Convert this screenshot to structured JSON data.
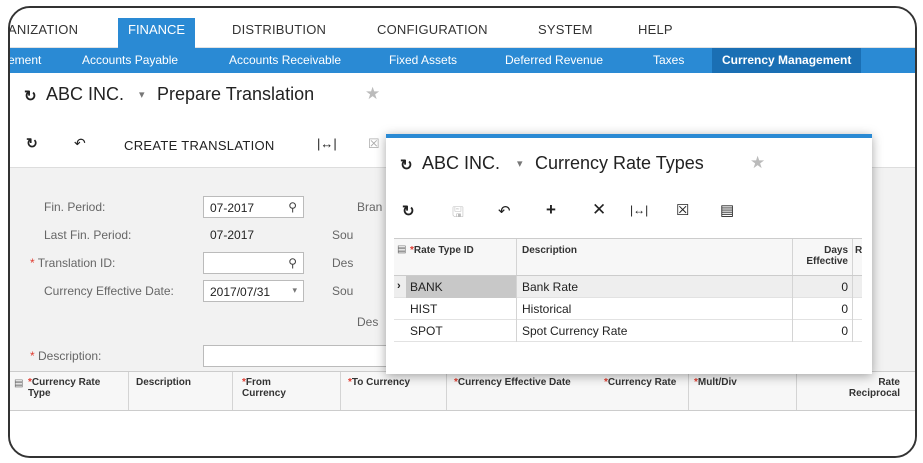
{
  "topnav": {
    "items": [
      "ANIZATION",
      "FINANCE",
      "DISTRIBUTION",
      "CONFIGURATION",
      "SYSTEM",
      "HELP"
    ],
    "active_index": 1
  },
  "subnav": {
    "items": [
      "ement",
      "Accounts Payable",
      "Accounts Receivable",
      "Fixed Assets",
      "Deferred Revenue",
      "Taxes",
      "Currency Management"
    ],
    "active_index": 6
  },
  "titlebar": {
    "company": "ABC INC.",
    "screen_title": "Prepare Translation"
  },
  "toolbar": {
    "create_translation": "CREATE TRANSLATION"
  },
  "form": {
    "fin_period_label": "Fin. Period:",
    "fin_period_value": "07-2017",
    "last_fin_period_label": "Last Fin. Period:",
    "last_fin_period_value": "07-2017",
    "translation_id_label": "Translation ID:",
    "translation_id_value": "",
    "currency_effective_date_label": "Currency Effective Date:",
    "currency_effective_date_value": "2017/07/31",
    "description_label": "Description:",
    "description_value": "",
    "right_labels": [
      "Bran",
      "Sou",
      "Des",
      "Sou",
      "Des"
    ]
  },
  "grid": {
    "columns": [
      {
        "label": "Currency Rate Type",
        "required": true
      },
      {
        "label": "Description",
        "required": false
      },
      {
        "label": "From Currency",
        "required": true
      },
      {
        "label": "To Currency",
        "required": true
      },
      {
        "label": "Currency Effective Date",
        "required": true
      },
      {
        "label": "Currency Rate",
        "required": true
      },
      {
        "label": "Mult/Div",
        "required": true
      },
      {
        "label": "Rate Reciprocal",
        "required": false
      }
    ]
  },
  "popup": {
    "company": "ABC INC.",
    "screen_title": "Currency Rate Types",
    "columns": [
      {
        "label": "Rate Type ID",
        "required": true
      },
      {
        "label": "Description",
        "required": false
      },
      {
        "label": "Days Effective",
        "required": false
      },
      {
        "label": "R",
        "required": false
      }
    ],
    "rows": [
      {
        "id": "BANK",
        "description": "Bank Rate",
        "days": "0",
        "selected": true
      },
      {
        "id": "HIST",
        "description": "Historical",
        "days": "0",
        "selected": false
      },
      {
        "id": "SPOT",
        "description": "Spot Currency Rate",
        "days": "0",
        "selected": false
      }
    ]
  },
  "colors": {
    "accent": "#2a8ad4",
    "accent_dark": "#1a6fb4",
    "required": "#e03c31"
  }
}
